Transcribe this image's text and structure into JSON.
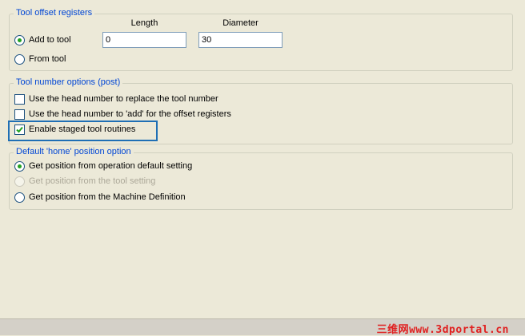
{
  "tool_offset": {
    "legend": "Tool offset registers",
    "length_label": "Length",
    "diameter_label": "Diameter",
    "add_to_tool_label": "Add to tool",
    "from_tool_label": "From tool",
    "length_value": "0",
    "diameter_value": "30"
  },
  "tool_number": {
    "legend": "Tool number options (post)",
    "replace_label": "Use the head number to replace the tool number",
    "add_label": "Use the head number to 'add' for the offset registers",
    "staged_label": "Enable staged tool routines"
  },
  "home_position": {
    "legend": "Default 'home' position option",
    "operation_label": "Get position from operation default setting",
    "tool_setting_label": "Get position from the tool setting",
    "machine_def_label": "Get position from the Machine Definition"
  },
  "watermark": "三维网www.3dportal.cn",
  "colors": {
    "background": "#ece9d8",
    "legend_text": "#0046d5",
    "highlight": "#1f6fb5",
    "watermark": "#e02020"
  }
}
